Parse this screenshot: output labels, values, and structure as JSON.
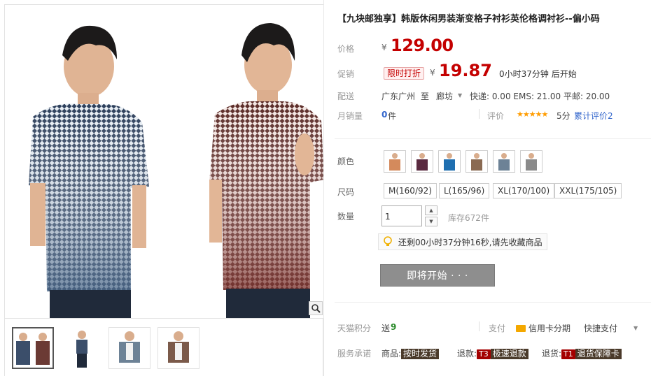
{
  "product": {
    "title": "【九块邮独享】韩版休闲男装渐变格子衬衫英伦格调衬衫--偏小码"
  },
  "price": {
    "label": "价格",
    "currency": "¥",
    "value": "129.00"
  },
  "promo": {
    "label": "促销",
    "badge": "限时打折",
    "currency": "¥",
    "value": "19.87",
    "countdown": "0小时37分钟 后开始"
  },
  "shipping": {
    "label": "配送",
    "from": "广东广州",
    "to_word": "至",
    "to": "廊坊",
    "fees": "快递: 0.00 EMS: 21.00 平邮: 20.00"
  },
  "sales": {
    "label": "月销量",
    "count": "0",
    "unit": "件",
    "review_label": "评价",
    "stars": "★★★★★",
    "score": "5分",
    "cumulative_label": "累计评价",
    "cumulative_count": "2"
  },
  "color": {
    "label": "颜色",
    "swatches": [
      "shirt-orange",
      "shirt-black",
      "shirt-blue",
      "shirt-brown",
      "shirt-denim",
      "shirt-white"
    ]
  },
  "size": {
    "label": "尺码",
    "options": [
      "M(160/92)",
      "L(165/96)",
      "XL(170/100)",
      "XXL(175/105)"
    ]
  },
  "quantity": {
    "label": "数量",
    "value": "1",
    "stock": "库存672件"
  },
  "reminder": {
    "text": "还剩00小时37分钟16秒,请先收藏商品"
  },
  "action": {
    "start_label": "即将开始 · · ·"
  },
  "tmall_points": {
    "label": "天猫积分",
    "prefix": "送",
    "value": "9"
  },
  "payment": {
    "label": "支付",
    "credit": "信用卡分期",
    "quick": "快捷支付"
  },
  "service": {
    "label": "服务承诺",
    "goods": "商品:",
    "goods_tag": "按时发货",
    "refund": "退款:",
    "refund_code": "T3",
    "refund_tag": "极速退款",
    "return": "退货:",
    "return_code": "T1",
    "return_tag": "退货保障卡"
  },
  "colors": {
    "price_red": "#c40000",
    "star_orange": "#ff9c00",
    "link_blue": "#3366cc",
    "button_gray": "#8e8e8e"
  }
}
